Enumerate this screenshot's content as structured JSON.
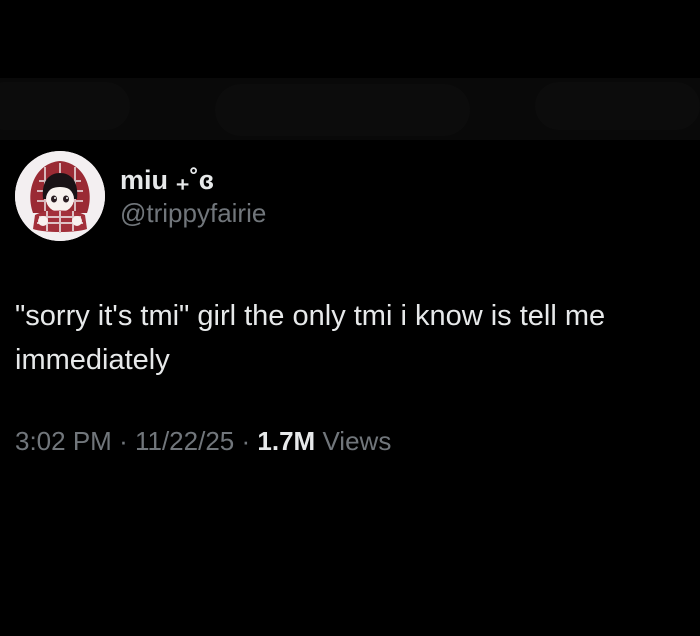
{
  "tweet": {
    "author": {
      "display_name": "miu ₊˚ɞ",
      "handle": "@trippyfairie",
      "avatar_icon": "anime-girl-avatar-icon"
    },
    "text": "\"sorry it's tmi\" girl the only tmi i know is tell me immediately",
    "time": "3:02 PM",
    "separator": "·",
    "date": "11/22/25",
    "views_count": "1.7M",
    "views_label": "Views"
  },
  "colors": {
    "background": "#000000",
    "primary_text": "#e7e9ea",
    "secondary_text": "#71767b",
    "redaction": "#0c0c0c"
  }
}
